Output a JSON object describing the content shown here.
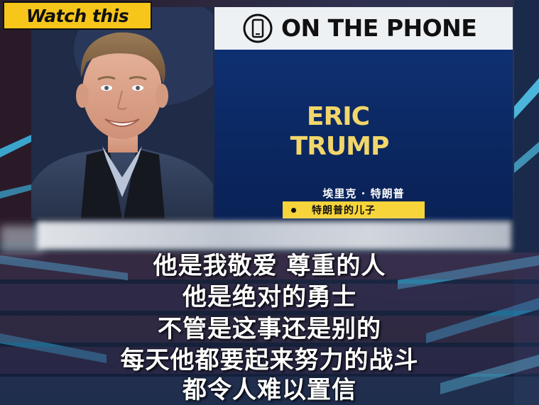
{
  "badge": {
    "label": "Watch this"
  },
  "card": {
    "header": "ON THE PHONE",
    "icon": "phone-icon",
    "name_first": "ERIC",
    "name_last": "TRUMP",
    "name_cn": "埃里克 · 特朗普",
    "role_cn": "特朗普的儿子"
  },
  "subtitles": [
    "他是我敬爱 尊重的人",
    "他是绝对的勇士",
    "不管是这事还是别的",
    "每天他都要起来努力的战斗",
    "都令人难以置信"
  ],
  "colors": {
    "badge": "#f6c61b",
    "card_blue": "#0c2a66",
    "name_gold": "#f2d66a",
    "role_yellow": "#f7d43a",
    "header_white": "#eef1f4"
  }
}
